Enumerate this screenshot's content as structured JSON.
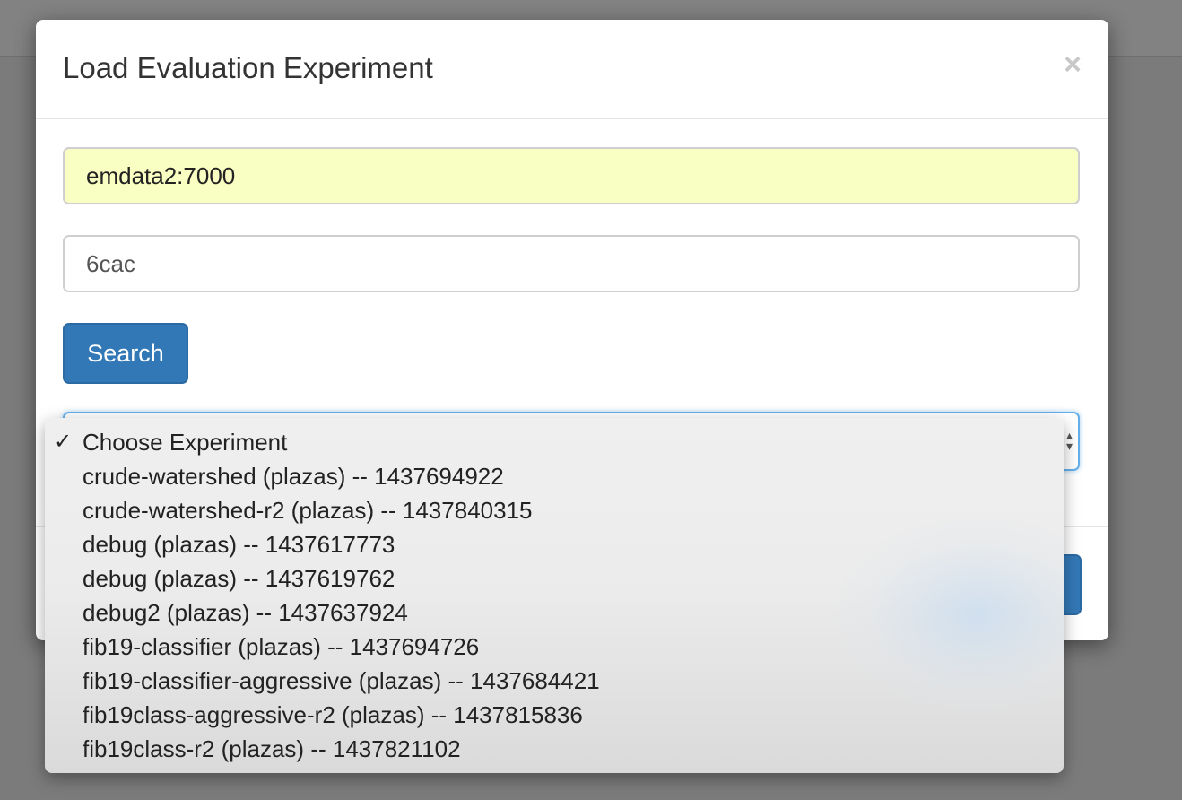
{
  "dialog": {
    "title": "Load Evaluation Experiment",
    "close_label": "×"
  },
  "form": {
    "server_value": "emdata2:7000",
    "uuid_value": "6cac",
    "search_label": "Search"
  },
  "experiment_select": {
    "selected_index": 0,
    "check_mark": "✓",
    "options": [
      "Choose Experiment",
      "crude-watershed (plazas) -- 1437694922",
      "crude-watershed-r2 (plazas) -- 1437840315",
      "debug (plazas) -- 1437617773",
      "debug (plazas) -- 1437619762",
      "debug2 (plazas) -- 1437637924",
      "fib19-classifier (plazas) -- 1437694726",
      "fib19-classifier-aggressive (plazas) -- 1437684421",
      "fib19class-aggressive-r2 (plazas) -- 1437815836",
      "fib19class-r2 (plazas) -- 1437821102"
    ]
  },
  "colors": {
    "primary_button": "#3378b6",
    "autofill_background": "#f9fec2",
    "focus_border": "#66afe9"
  }
}
